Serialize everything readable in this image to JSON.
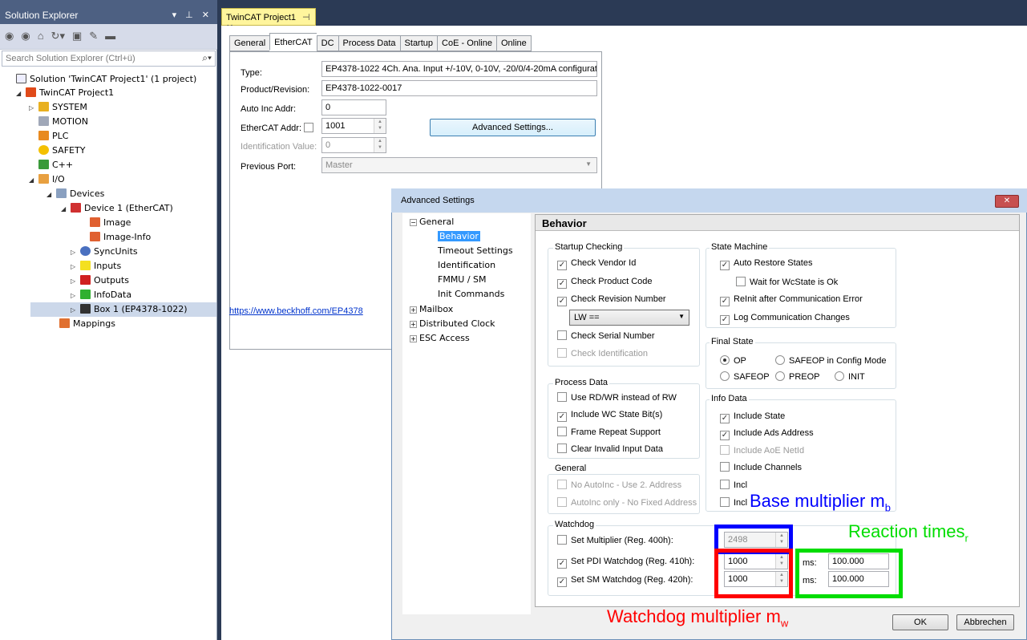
{
  "solution_explorer": {
    "title": "Solution Explorer",
    "title_controls": "▾ ⊥ ✕",
    "search_placeholder": "Search Solution Explorer (Ctrl+ü)",
    "tree": [
      {
        "label": "Solution 'TwinCAT Project1' (1 project)",
        "icon": "solution-icon"
      },
      {
        "label": "TwinCAT Project1",
        "icon": "project-icon"
      },
      {
        "label": "SYSTEM",
        "icon": "system-icon"
      },
      {
        "label": "MOTION",
        "icon": "motion-icon"
      },
      {
        "label": "PLC",
        "icon": "plc-icon"
      },
      {
        "label": "SAFETY",
        "icon": "safety-icon"
      },
      {
        "label": "C++",
        "icon": "cpp-icon"
      },
      {
        "label": "I/O",
        "icon": "io-icon"
      },
      {
        "label": "Devices",
        "icon": "devices-icon"
      },
      {
        "label": "Device 1 (EtherCAT)",
        "icon": "ethercat-icon"
      },
      {
        "label": "Image",
        "icon": "image-icon"
      },
      {
        "label": "Image-Info",
        "icon": "image-info-icon"
      },
      {
        "label": "SyncUnits",
        "icon": "syncunits-icon"
      },
      {
        "label": "Inputs",
        "icon": "inputs-icon"
      },
      {
        "label": "Outputs",
        "icon": "outputs-icon"
      },
      {
        "label": "InfoData",
        "icon": "infodata-icon"
      },
      {
        "label": "Box 1 (EP4378-1022)",
        "icon": "box-icon"
      },
      {
        "label": "Mappings",
        "icon": "mappings-icon"
      }
    ]
  },
  "document": {
    "tab_title": "TwinCAT Project1",
    "tab_controls": "⊣ ✕",
    "tabs": [
      "General",
      "EtherCAT",
      "DC",
      "Process Data",
      "Startup",
      "CoE - Online",
      "Online"
    ],
    "active_tab": "EtherCAT",
    "fields": {
      "type_label": "Type:",
      "type_value": "EP4378-1022 4Ch. Ana. Input +/-10V, 0-10V, -20/0/4-20mA configurat",
      "product_label": "Product/Revision:",
      "product_value": "EP4378-1022-0017",
      "autoinc_label": "Auto Inc Addr:",
      "autoinc_value": "0",
      "ethercat_label": "EtherCAT Addr:",
      "ethercat_value": "1001",
      "ident_label": "Identification Value:",
      "ident_value": "0",
      "prevport_label": "Previous Port:",
      "prevport_value": "Master"
    },
    "advanced_button": "Advanced Settings...",
    "link": "https://www.beckhoff.com/EP4378"
  },
  "dialog": {
    "title": "Advanced Settings",
    "close_label": "✕",
    "tree": {
      "general": "General",
      "behavior": "Behavior",
      "timeout": "Timeout Settings",
      "identification": "Identification",
      "fmmu": "FMMU / SM",
      "init": "Init Commands",
      "mailbox": "Mailbox",
      "dc": "Distributed Clock",
      "esc": "ESC Access"
    },
    "panel_title": "Behavior",
    "startup": {
      "title": "Startup Checking",
      "vendor": "Check Vendor Id",
      "product": "Check Product Code",
      "revision": "Check Revision Number",
      "revision_option": "LW ==",
      "serial": "Check Serial Number",
      "ident": "Check Identification"
    },
    "state_machine": {
      "title": "State Machine",
      "auto_restore": "Auto Restore States",
      "wait_wc": "Wait for WcState is Ok",
      "reinit": "ReInit after Communication Error",
      "log": "Log Communication Changes"
    },
    "final_state": {
      "title": "Final State",
      "op": "OP",
      "safeop_cfg": "SAFEOP in Config Mode",
      "safeop": "SAFEOP",
      "preop": "PREOP",
      "init": "INIT"
    },
    "process_data": {
      "title": "Process Data",
      "rdwr": "Use RD/WR instead of RW",
      "wc": "Include WC State Bit(s)",
      "frame": "Frame Repeat Support",
      "clear": "Clear Invalid Input Data"
    },
    "info_data": {
      "title": "Info Data",
      "state": "Include State",
      "ads": "Include Ads Address",
      "aoe": "Include AoE NetId",
      "channels": "Include Channels",
      "incl5": "Incl",
      "incl6": "Incl"
    },
    "general_group": {
      "title": "General",
      "noautoinc": "No AutoInc - Use 2. Address",
      "autoinc_only": "AutoInc only - No Fixed Address"
    },
    "watchdog": {
      "title": "Watchdog",
      "multiplier_label": "Set Multiplier (Reg. 400h):",
      "multiplier_value": "2498",
      "pdi_label": "Set PDI Watchdog (Reg. 410h):",
      "pdi_value": "1000",
      "pdi_ms_label": "ms:",
      "pdi_ms_value": "100.000",
      "sm_label": "Set SM Watchdog (Reg. 420h):",
      "sm_value": "1000",
      "sm_ms_label": "ms:",
      "sm_ms_value": "100.000"
    },
    "ok": "OK",
    "cancel": "Abbrechen"
  },
  "annotations": {
    "base": "Base multiplier m",
    "base_sub": "b",
    "reaction": "Reaction time",
    "reaction_tail": "s",
    "reaction_sub": "r",
    "watchdog": "Watchdog multiplier m",
    "watchdog_sub": "w",
    "colors": {
      "blue": "#0000ff",
      "green": "#00dd00",
      "red": "#ff0000"
    }
  }
}
